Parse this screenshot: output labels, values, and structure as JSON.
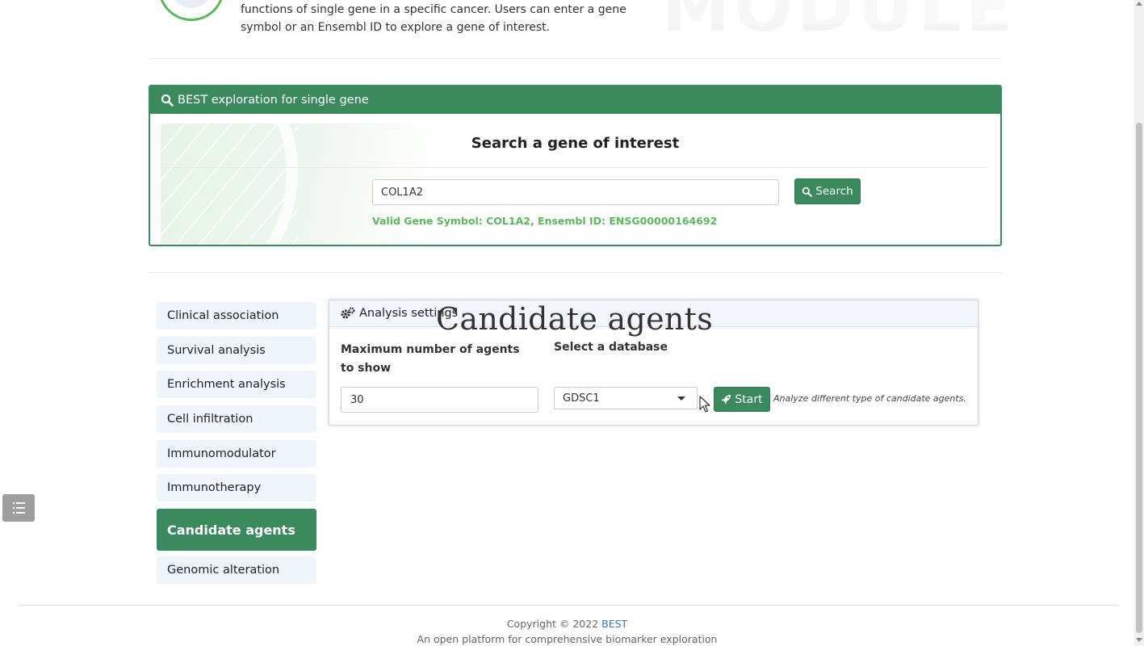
{
  "intro": {
    "line1": "functions of single gene in a specific cancer. Users can enter a gene",
    "line2": "symbol or an Ensembl ID to explore a gene of interest."
  },
  "watermark": "MODULE",
  "search_panel": {
    "header": "BEST exploration for single gene",
    "title": "Search a gene of interest",
    "gene_value": "COL1A2",
    "search_label": "Search",
    "valid_message": "Valid Gene Symbol: COL1A2, Ensembl ID: ENSG00000164692"
  },
  "sidebar": {
    "items": [
      {
        "label": "Clinical association"
      },
      {
        "label": "Survival analysis"
      },
      {
        "label": "Enrichment analysis"
      },
      {
        "label": "Cell infiltration"
      },
      {
        "label": "Immunomodulator"
      },
      {
        "label": "Immunotherapy"
      },
      {
        "label": "Candidate agents",
        "active": true
      },
      {
        "label": "Genomic alteration"
      }
    ]
  },
  "analysis": {
    "overlay_title": "Candidate agents",
    "header": "Analysis settings",
    "max_agents_label": "Maximum number of agents to show",
    "max_agents_value": "30",
    "db_label": "Select a database",
    "db_selected": "GDSC1",
    "start_label": "Start",
    "start_hint": "Analyze different type of candidate agents."
  },
  "footer": {
    "copyright_prefix": "Copyright © 2022 ",
    "brand_link": "BEST",
    "tagline": "An open platform for comprehensive biomarker exploration"
  },
  "colors": {
    "primary_green": "#3a8a5e",
    "valid_green": "#5cb85c",
    "link_blue": "#337ab7",
    "nav_bg": "#eef6fb"
  },
  "icons": {
    "search": "search-icon",
    "settings": "cogs-icon",
    "start": "rocket-icon",
    "toc": "list-icon"
  }
}
